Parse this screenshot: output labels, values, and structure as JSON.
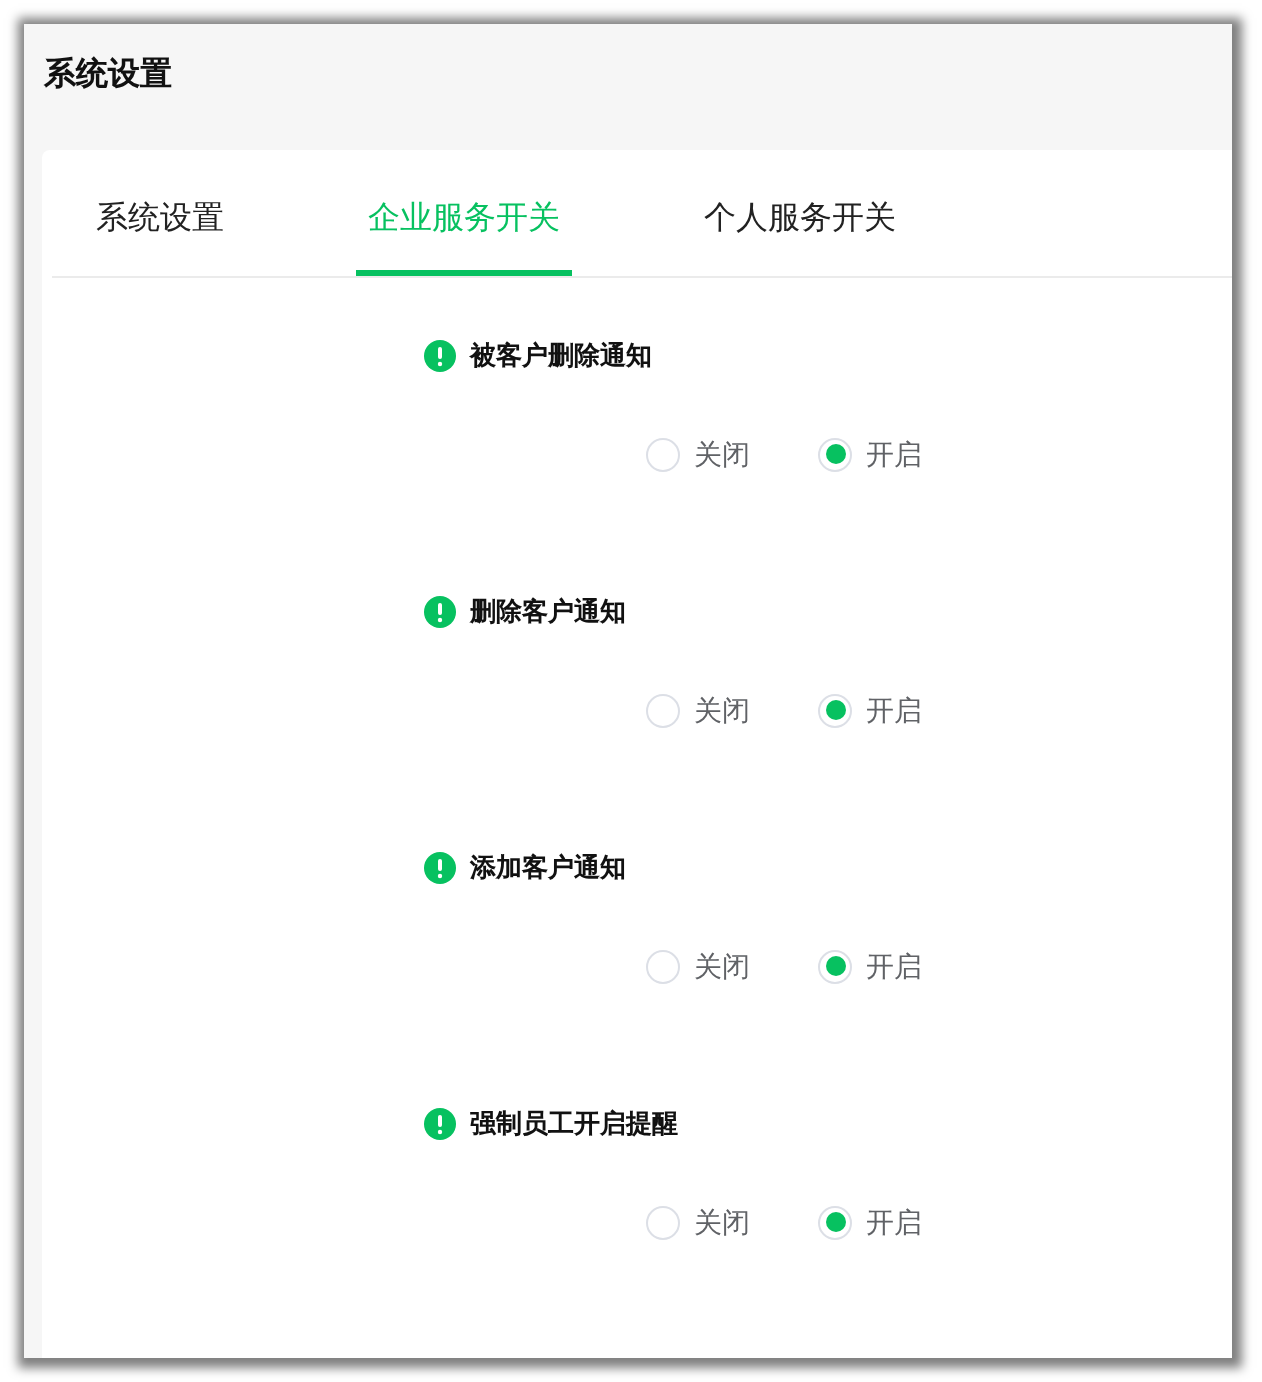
{
  "window": {
    "title": "系统设置"
  },
  "tabs": [
    {
      "label": "系统设置",
      "selected": false
    },
    {
      "label": "企业服务开关",
      "selected": true
    },
    {
      "label": "个人服务开关",
      "selected": false
    }
  ],
  "settings": [
    {
      "title": "被客户删除通知",
      "options": [
        {
          "label": "关闭",
          "selected": false
        },
        {
          "label": "开启",
          "selected": true
        }
      ]
    },
    {
      "title": "删除客户通知",
      "options": [
        {
          "label": "关闭",
          "selected": false
        },
        {
          "label": "开启",
          "selected": true
        }
      ]
    },
    {
      "title": "添加客户通知",
      "options": [
        {
          "label": "关闭",
          "selected": false
        },
        {
          "label": "开启",
          "selected": true
        }
      ]
    },
    {
      "title": "强制员工开启提醒",
      "options": [
        {
          "label": "关闭",
          "selected": false
        },
        {
          "label": "开启",
          "selected": true
        }
      ]
    }
  ]
}
